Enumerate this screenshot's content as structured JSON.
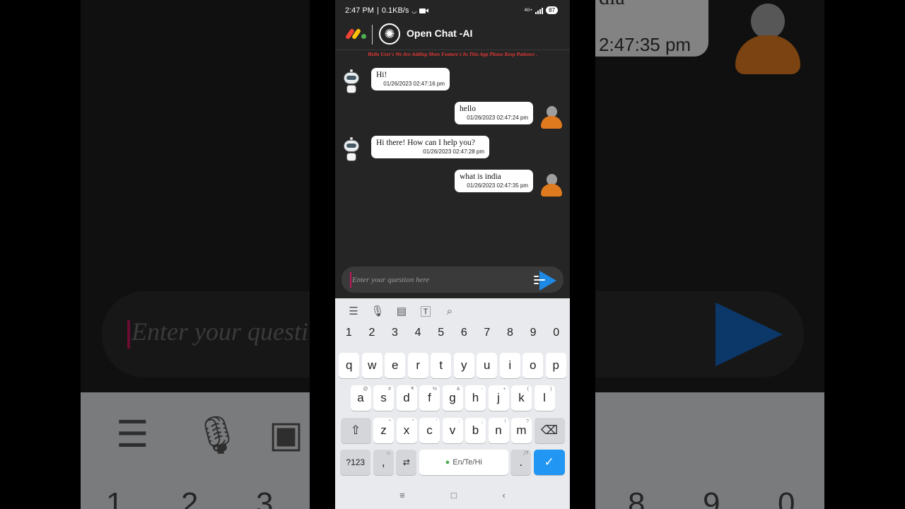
{
  "status_bar": {
    "time": "2:47 PM",
    "speed": "0.1KB/s",
    "network": "4G+",
    "battery": "87"
  },
  "app": {
    "title": "Open Chat -AI",
    "notice": "Hello User's We Are Adding More Feature's In This App Please Keep Patience ."
  },
  "messages": [
    {
      "sender": "bot",
      "text": "Hi!",
      "timestamp": "01/26/2023 02:47:16 pm"
    },
    {
      "sender": "user",
      "text": "hello",
      "timestamp": "01/26/2023 02:47:24 pm"
    },
    {
      "sender": "bot",
      "text": "Hi there! How can I help you?",
      "timestamp": "01/26/2023 02:47:28 pm"
    },
    {
      "sender": "user",
      "text": "what is india",
      "timestamp": "01/26/2023 02:47:35 pm"
    }
  ],
  "input": {
    "placeholder": "Enter your question here"
  },
  "keyboard": {
    "numbers": [
      "1",
      "2",
      "3",
      "4",
      "5",
      "6",
      "7",
      "8",
      "9",
      "0"
    ],
    "row1": [
      "q",
      "w",
      "e",
      "r",
      "t",
      "y",
      "u",
      "i",
      "o",
      "p"
    ],
    "row2": [
      {
        "k": "a",
        "s": "@"
      },
      {
        "k": "s",
        "s": "#"
      },
      {
        "k": "d",
        "s": "₹"
      },
      {
        "k": "f",
        "s": "%"
      },
      {
        "k": "g",
        "s": "&"
      },
      {
        "k": "h",
        "s": "-"
      },
      {
        "k": "j",
        "s": "+"
      },
      {
        "k": "k",
        "s": "("
      },
      {
        "k": "l",
        "s": ")"
      }
    ],
    "row3": [
      {
        "k": "z",
        "s": "*"
      },
      {
        "k": "x",
        "s": "\""
      },
      {
        "k": "c",
        "s": "'"
      },
      {
        "k": "v",
        "s": ":"
      },
      {
        "k": "b",
        "s": ";"
      },
      {
        "k": "n",
        "s": "!"
      },
      {
        "k": "m",
        "s": "?"
      }
    ],
    "sym_label": "?123",
    "comma": ",",
    "space_label": "En/Te/Hi",
    "period": ".",
    "period_alt": ",!?"
  },
  "background_zoom": {
    "placeholder_fragment": "Enter your questi",
    "time_fragment": "2:47:35 pm",
    "text_fragment": "dia",
    "numbers": [
      "1",
      "2",
      "3",
      "8",
      "9",
      "0"
    ]
  },
  "colors": {
    "accent": "#2196f3",
    "notice": "#e53935",
    "user_avatar": "#e07a1f",
    "send": "#1e88e5"
  }
}
